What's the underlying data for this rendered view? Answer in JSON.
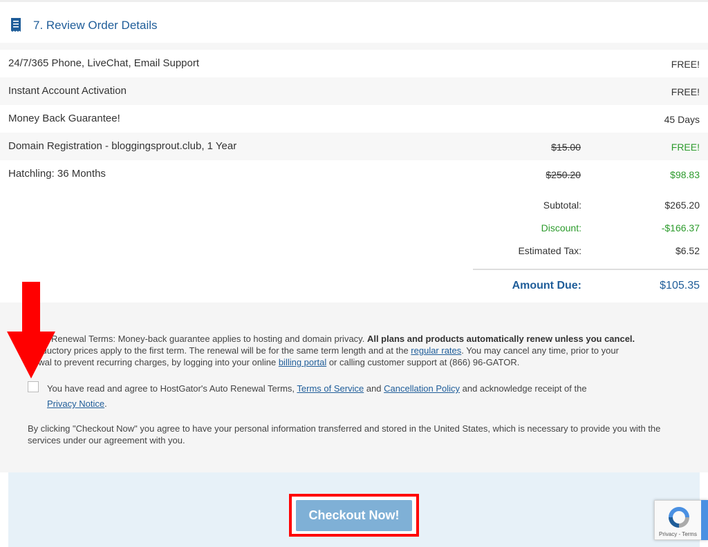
{
  "section": {
    "title": "7. Review Order Details",
    "icon": "receipt-icon"
  },
  "items": [
    {
      "label": "24/7/365 Phone, LiveChat, Email Support",
      "original": "",
      "value": "FREE!",
      "value_color": "default"
    },
    {
      "label": "Instant Account Activation",
      "original": "",
      "value": "FREE!",
      "value_color": "default"
    },
    {
      "label": "Money Back Guarantee!",
      "original": "",
      "value": "45 Days",
      "value_color": "default"
    },
    {
      "label": "Domain Registration - bloggingsprout.club, 1 Year",
      "original": "$15.00",
      "value": "FREE!",
      "value_color": "green"
    },
    {
      "label": "Hatchling: 36 Months",
      "original": "$250.20",
      "value": "$98.83",
      "value_color": "green"
    }
  ],
  "totals": {
    "subtotal_label": "Subtotal:",
    "subtotal_value": "$265.20",
    "discount_label": "Discount:",
    "discount_value": "-$166.37",
    "tax_label": "Estimated Tax:",
    "tax_value": "$6.52",
    "due_label": "Amount Due:",
    "due_value": "$105.35"
  },
  "terms": {
    "line1_start": "Renewal Terms: Money-back guarantee applies to hosting and domain privacy. ",
    "line1_bold": "All plans and products automatically renew unless you cancel.",
    "line2_start": "roductory prices apply to the first term. The renewal will be for the same term length and at the ",
    "regular_rates_link": "regular rates",
    "line2_end": ". You may cancel any time, prior to your",
    "line3_start": "ewal to prevent recurring charges, by logging into your online ",
    "billing_portal_link": "billing portal",
    "line3_end": " or calling customer support at (866) 96-GATOR."
  },
  "agreement": {
    "start": "You have read and agree to HostGator's Auto Renewal Terms, ",
    "tos_link": "Terms of Service",
    "and": " and ",
    "cancel_link": "Cancellation Policy",
    "end": " and acknowledge receipt of the",
    "privacy_link": "Privacy Notice",
    "period": ".",
    "checked": false
  },
  "notice": "By clicking \"Checkout Now\" you agree to have your personal information transferred and stored in the United States, which is necessary to provide you with the services under our agreement with you.",
  "checkout": {
    "label": "Checkout Now!"
  },
  "recaptcha": {
    "text": "Privacy - Terms"
  },
  "colors": {
    "accent_blue": "#1f5d99",
    "green": "#2c9b2c",
    "annotation_red": "#ff0000",
    "button_blue": "#7fb0d6"
  }
}
